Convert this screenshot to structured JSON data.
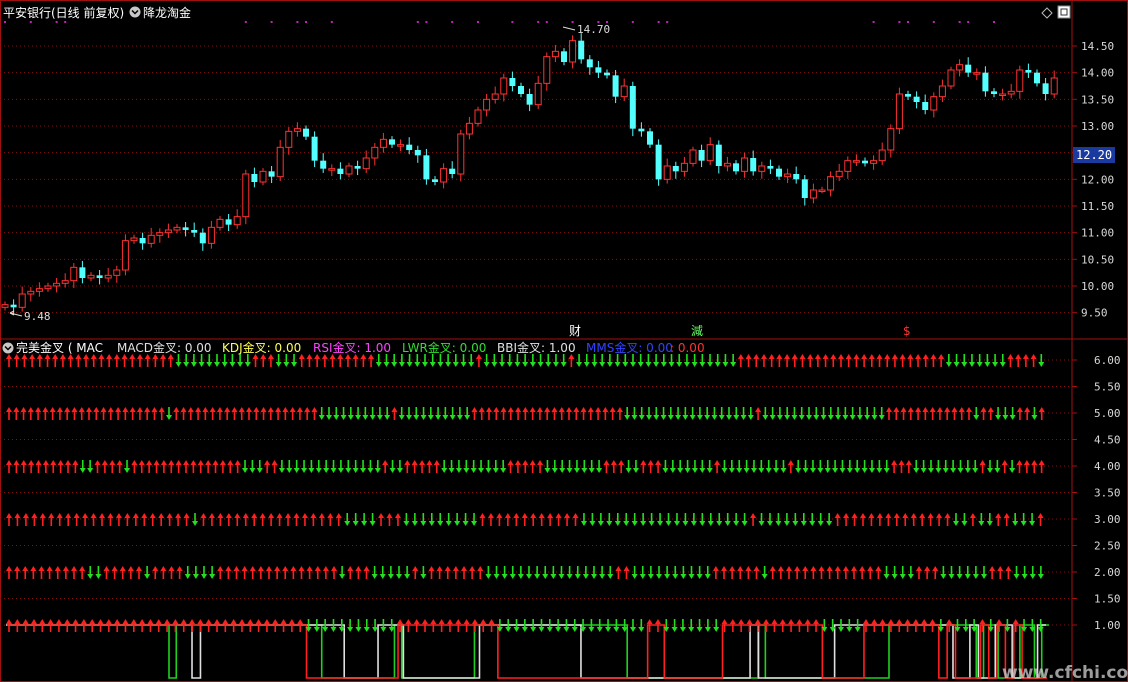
{
  "header": {
    "stock_title": "平安银行(日线 前复权)",
    "indicator_name": "降龙淘金",
    "low_label": "9.48",
    "high_label": "14.70",
    "current_price": "12.20"
  },
  "event_markers": [
    {
      "text": "财",
      "color": "#ffffff"
    },
    {
      "text": "減",
      "color": "#66ff66"
    },
    {
      "text": "$",
      "color": "#ff3333"
    }
  ],
  "indicator_header": {
    "name": "完美金叉 ( MAC",
    "items": [
      {
        "label": "MACD金叉: 0.00",
        "color": "#e0e0e0"
      },
      {
        "label": "KDJ金叉: 0.00",
        "color": "#ffff55"
      },
      {
        "label": "RSI金叉: 1.00",
        "color": "#ff44ff"
      },
      {
        "label": "LWR金叉: 0.00",
        "color": "#33dd33"
      },
      {
        "label": "BBI金叉: 1.00",
        "color": "#e0e0e0"
      },
      {
        "label": "MMS金叉: 0.00",
        "color": "#3344ff"
      },
      {
        "label": ": 0.00",
        "color": "#ff3333"
      }
    ]
  },
  "watermark": "www.cfchi.com",
  "icons": {
    "collapse": "chevron-down-icon",
    "diamond": "diamond-icon",
    "restore": "window-restore-icon"
  },
  "colors": {
    "up": "#ff3232",
    "down": "#54ffff",
    "arrow_up": "#ff2020",
    "arrow_down": "#20e020",
    "frame": "#a01010",
    "dots": "#c020c0"
  },
  "chart_data": [
    {
      "type": "candlestick",
      "title": "平安银行(日线 前复权)",
      "y_ticks": [
        "14.50",
        "14.00",
        "13.50",
        "13.00",
        "12.50",
        "12.00",
        "11.50",
        "11.00",
        "10.50",
        "10.00",
        "9.50"
      ],
      "ylim": [
        9.1,
        14.95
      ],
      "grid": true,
      "closes": [
        9.65,
        9.6,
        9.85,
        9.9,
        9.95,
        10.0,
        10.05,
        10.1,
        10.35,
        10.15,
        10.2,
        10.15,
        10.2,
        10.3,
        10.85,
        10.9,
        10.8,
        10.95,
        11.0,
        11.05,
        11.1,
        11.05,
        11.0,
        10.8,
        11.1,
        11.25,
        11.15,
        11.3,
        12.1,
        11.95,
        12.15,
        12.05,
        12.6,
        12.9,
        12.95,
        12.8,
        12.35,
        12.2,
        12.2,
        12.1,
        12.25,
        12.2,
        12.4,
        12.6,
        12.75,
        12.65,
        12.65,
        12.55,
        12.45,
        12.0,
        11.95,
        12.2,
        12.1,
        12.85,
        13.05,
        13.3,
        13.5,
        13.6,
        13.9,
        13.75,
        13.6,
        13.4,
        13.8,
        14.3,
        14.4,
        14.2,
        14.6,
        14.25,
        14.1,
        14.0,
        13.95,
        13.55,
        13.75,
        12.95,
        12.9,
        12.65,
        12.0,
        12.25,
        12.15,
        12.3,
        12.55,
        12.35,
        12.65,
        12.25,
        12.3,
        12.15,
        12.4,
        12.15,
        12.25,
        12.2,
        12.05,
        12.1,
        12.0,
        11.65,
        11.8,
        11.8,
        12.05,
        12.15,
        12.35,
        12.35,
        12.3,
        12.35,
        12.55,
        12.95,
        13.6,
        13.55,
        13.45,
        13.3,
        13.55,
        13.75,
        14.05,
        14.15,
        14.0,
        14.0,
        13.65,
        13.6,
        13.6,
        13.65,
        14.05,
        14.0,
        13.8,
        13.6,
        13.9
      ],
      "events": [
        "财",
        "減",
        "$"
      ]
    },
    {
      "type": "signal-arrows",
      "title": "完美金叉",
      "y_ticks": [
        "6.00",
        "5.50",
        "5.00",
        "4.50",
        "4.00",
        "3.50",
        "3.00",
        "2.50",
        "2.00",
        "1.50",
        "1.00"
      ],
      "ylim": [
        0,
        6.3
      ],
      "rows": [
        {
          "level": 6,
          "pattern": "22u10d3u3d10u13d1u11d1u21d27u8d4u1d"
        },
        {
          "level": 5,
          "pattern": "22u1d20u10d1u10d21u18d1u17d12u1d2u3d2u1d1u"
        },
        {
          "level": 4,
          "pattern": "10u2d4u1d15u3d2u14d1u2d5u9d5u8d3u2d3u7d1u9d1u13d3u9d1u2d1u1d4u"
        },
        {
          "level": 3,
          "pattern": "22u1d17u4d3u9d12u20d1u9d14u2d1u2d2u3d1u"
        },
        {
          "level": 2,
          "pattern": "10u2d5u1d4u4d15u1d3u5d1u1d7u16d2u10d6u1d14u4d3u6d3u4d"
        },
        {
          "level": 1,
          "pattern": "36u11d12u18d2u7d12u5d9u1d1u3d1u1d1u1d1u3d"
        }
      ]
    }
  ]
}
